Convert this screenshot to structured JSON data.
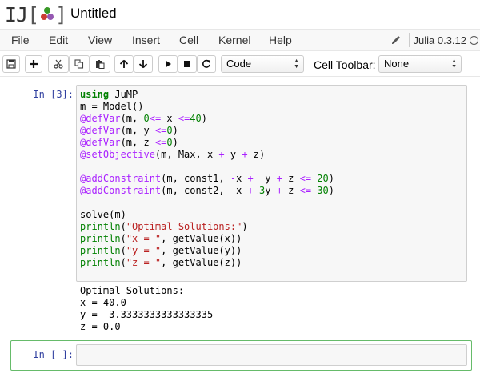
{
  "header": {
    "logo_text": "IJ",
    "bracket_open": "[",
    "bracket_close": "]",
    "title": "Untitled"
  },
  "menubar": {
    "items": [
      "File",
      "Edit",
      "View",
      "Insert",
      "Cell",
      "Kernel",
      "Help"
    ],
    "kernel_name": "Julia 0.3.12"
  },
  "toolbar": {
    "cell_type": "Code",
    "cell_toolbar_label": "Cell Toolbar:",
    "cell_toolbar_value": "None"
  },
  "cells": {
    "cell1": {
      "prompt": "In [3]:",
      "code": [
        [
          [
            "kw",
            "using"
          ],
          [
            "",
            " JuMP"
          ]
        ],
        [
          [
            "",
            "m = Model()"
          ]
        ],
        [
          [
            "mac",
            "@defVar"
          ],
          [
            "",
            "(m, "
          ],
          [
            "num",
            "0"
          ],
          [
            "op",
            "<="
          ],
          [
            "",
            " x "
          ],
          [
            "op",
            "<="
          ],
          [
            "num",
            "40"
          ],
          [
            "",
            ")"
          ]
        ],
        [
          [
            "mac",
            "@defVar"
          ],
          [
            "",
            "(m, y "
          ],
          [
            "op",
            "<="
          ],
          [
            "num",
            "0"
          ],
          [
            "",
            ")"
          ]
        ],
        [
          [
            "mac",
            "@defVar"
          ],
          [
            "",
            "(m, z "
          ],
          [
            "op",
            "<="
          ],
          [
            "num",
            "0"
          ],
          [
            "",
            ")"
          ]
        ],
        [
          [
            "mac",
            "@setObjective"
          ],
          [
            "",
            "(m, Max, x "
          ],
          [
            "op",
            "+"
          ],
          [
            "",
            " y "
          ],
          [
            "op",
            "+"
          ],
          [
            "",
            " z)"
          ]
        ],
        [
          [
            "",
            ""
          ]
        ],
        [
          [
            "mac",
            "@addConstraint"
          ],
          [
            "",
            "(m, const1, "
          ],
          [
            "op",
            "-"
          ],
          [
            "",
            "x "
          ],
          [
            "op",
            "+"
          ],
          [
            "",
            "  y "
          ],
          [
            "op",
            "+"
          ],
          [
            "",
            " z "
          ],
          [
            "op",
            "<="
          ],
          [
            "",
            " "
          ],
          [
            "num",
            "20"
          ],
          [
            "",
            ")"
          ]
        ],
        [
          [
            "mac",
            "@addConstraint"
          ],
          [
            "",
            "(m, const2,  x "
          ],
          [
            "op",
            "+"
          ],
          [
            "",
            " "
          ],
          [
            "num",
            "3"
          ],
          [
            "",
            "y "
          ],
          [
            "op",
            "+"
          ],
          [
            "",
            " z "
          ],
          [
            "op",
            "<="
          ],
          [
            "",
            " "
          ],
          [
            "num",
            "30"
          ],
          [
            "",
            ")"
          ]
        ],
        [
          [
            "",
            ""
          ]
        ],
        [
          [
            "",
            "solve(m)"
          ]
        ],
        [
          [
            "fn",
            "println"
          ],
          [
            "",
            "("
          ],
          [
            "str",
            "\"Optimal Solutions:\""
          ],
          [
            "",
            ")"
          ]
        ],
        [
          [
            "fn",
            "println"
          ],
          [
            "",
            "("
          ],
          [
            "str",
            "\"x = \""
          ],
          [
            "",
            ", getValue(x))"
          ]
        ],
        [
          [
            "fn",
            "println"
          ],
          [
            "",
            "("
          ],
          [
            "str",
            "\"y = \""
          ],
          [
            "",
            ", getValue(y))"
          ]
        ],
        [
          [
            "fn",
            "println"
          ],
          [
            "",
            "("
          ],
          [
            "str",
            "\"z = \""
          ],
          [
            "",
            ", getValue(z))"
          ]
        ]
      ],
      "output": [
        "Optimal Solutions:",
        "x = 40.0",
        "y = -3.3333333333333335",
        "z = 0.0"
      ]
    },
    "cell2": {
      "prompt": "In [ ]:"
    }
  },
  "colors": {
    "prompt": "#303f9f",
    "selected_border": "#66bb6a",
    "keyword": "#008000",
    "macro": "#aa22ff",
    "string": "#ba2121"
  },
  "icons": [
    "pencil-icon",
    "save-icon",
    "plus-icon",
    "cut-icon",
    "copy-icon",
    "paste-icon",
    "move-up-icon",
    "move-down-icon",
    "run-icon",
    "stop-icon",
    "restart-icon",
    "kernel-idle-icon"
  ]
}
